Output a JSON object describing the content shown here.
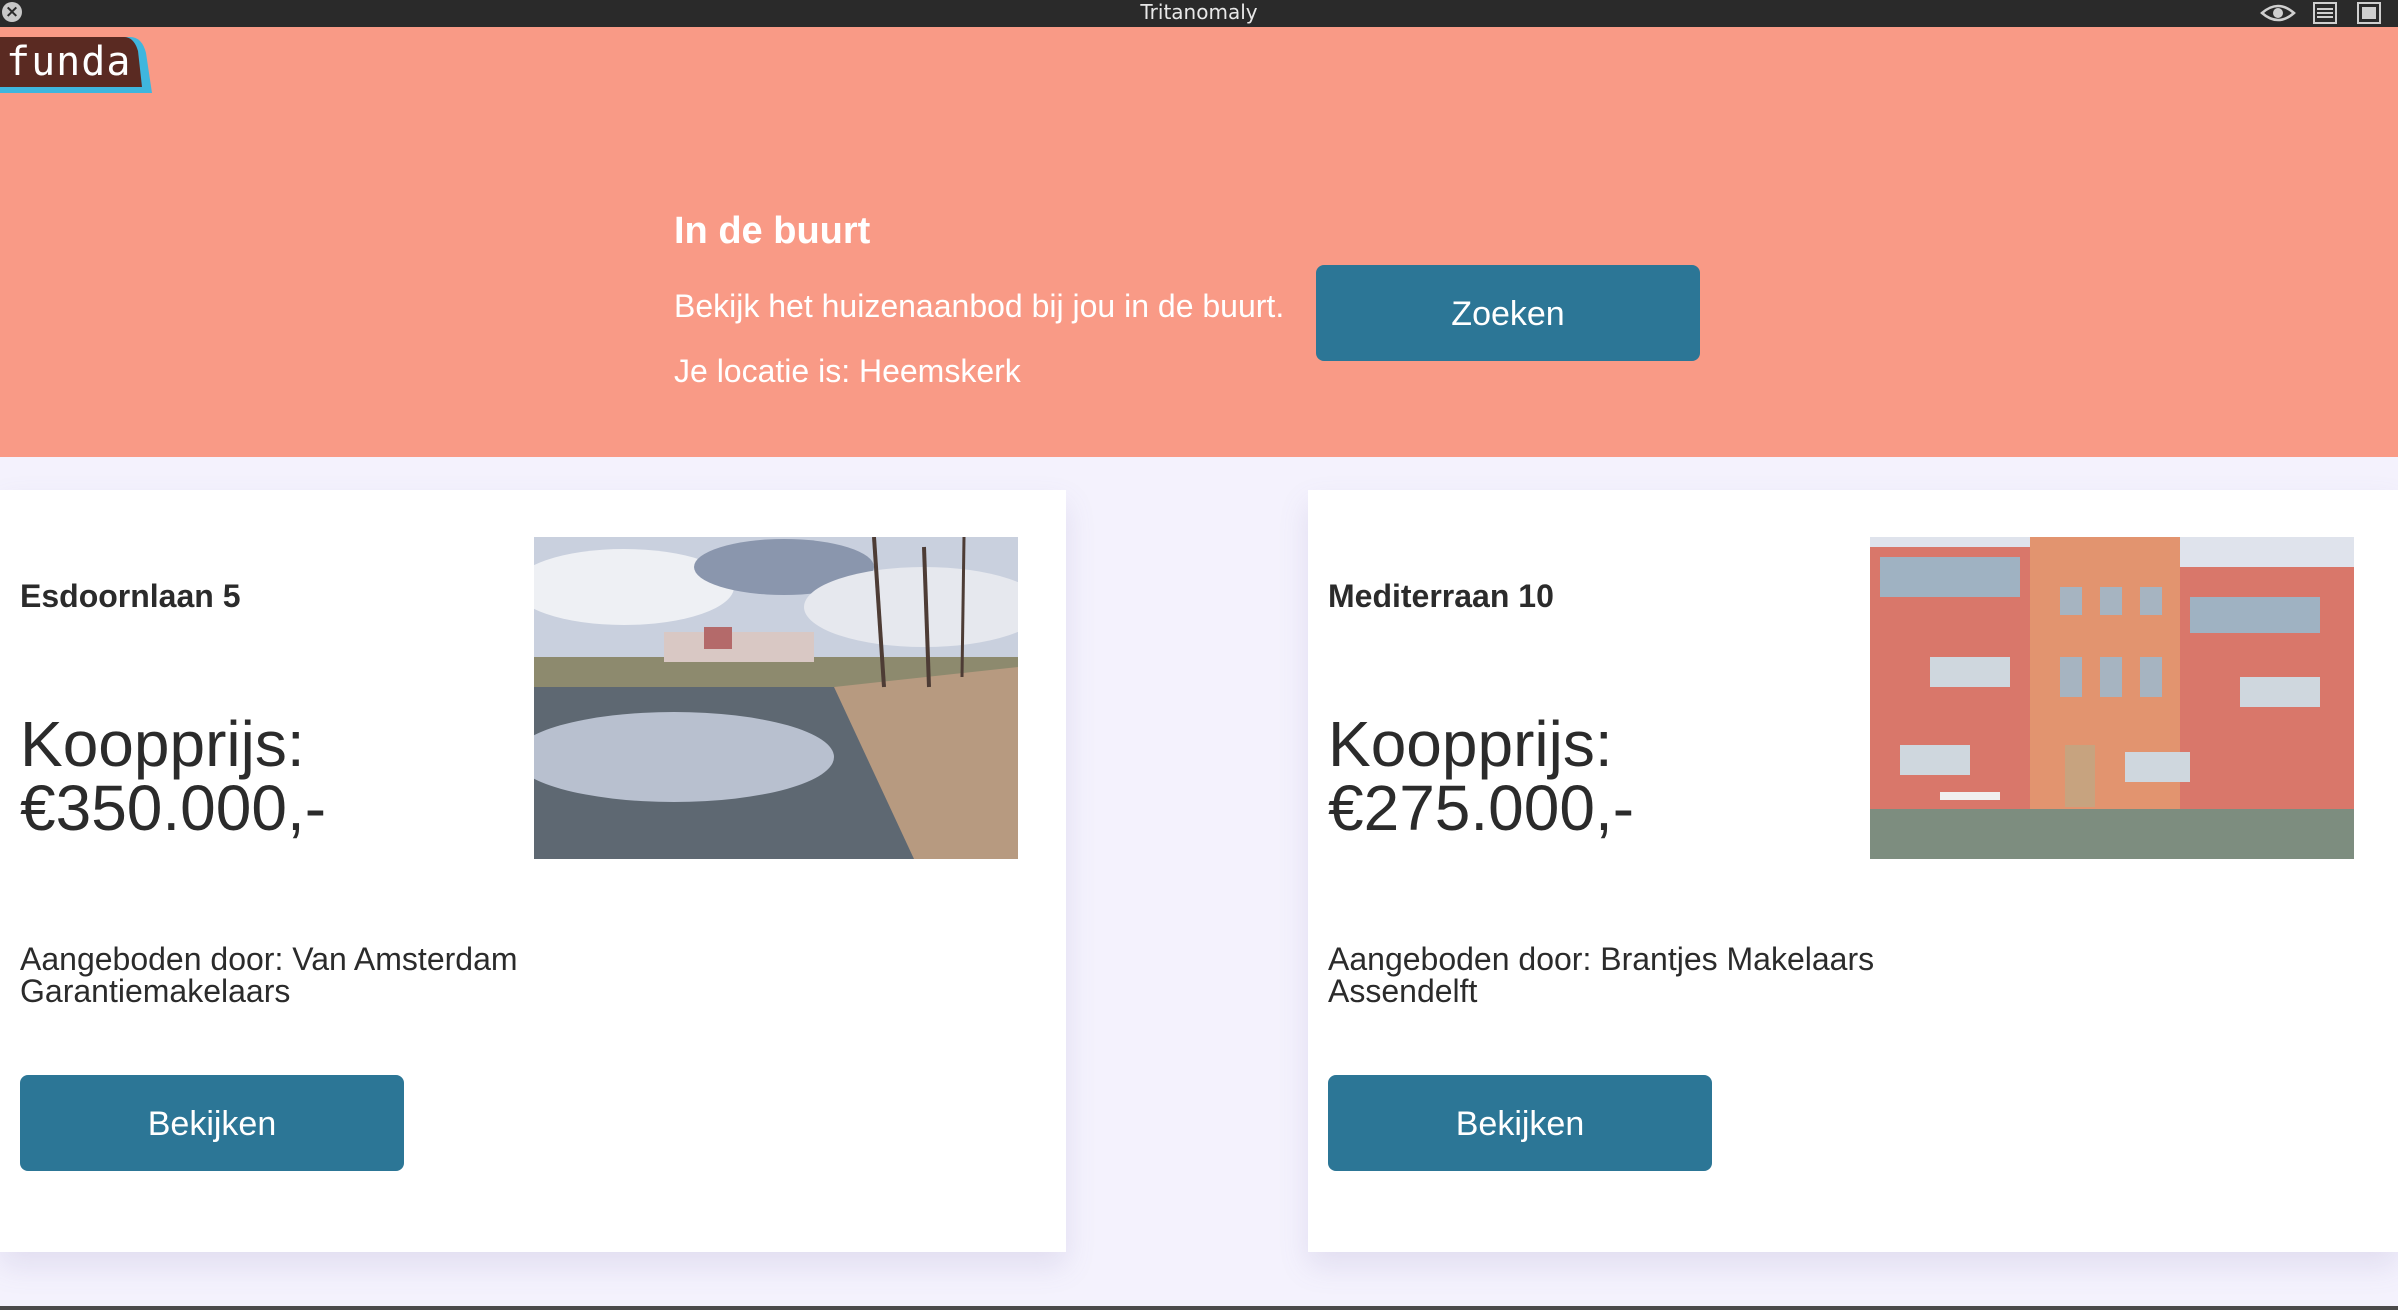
{
  "window": {
    "title": "Tritanomaly"
  },
  "logo": {
    "text": "funda"
  },
  "hero": {
    "title": "In de buurt",
    "description": "Bekijk het huizenaanbod bij jou in de buurt.",
    "location": "Je locatie is: Heemskerk",
    "search_label": "Zoeken"
  },
  "listings": [
    {
      "street": "Esdoornlaan 5",
      "price_label": "Koopprijs:",
      "price": "€350.000,-",
      "offered_by": "Aangeboden door: Van Amsterdam Garantiemakelaars",
      "view_label": "Bekijken"
    },
    {
      "street": "Mediterraan 10",
      "price_label": "Koopprijs:",
      "price": "€275.000,-",
      "offered_by": "Aangeboden door: Brantjes Makelaars Assendelft",
      "view_label": "Bekijken"
    }
  ],
  "colors": {
    "hero_bg": "#f99a86",
    "button": "#2c7696",
    "logo_bg": "#5a2a22",
    "logo_outline": "#3fb6de",
    "page_bg": "#f4f2fd"
  },
  "icons": [
    "close-icon",
    "eye-icon",
    "list-view-icon",
    "panel-icon"
  ]
}
